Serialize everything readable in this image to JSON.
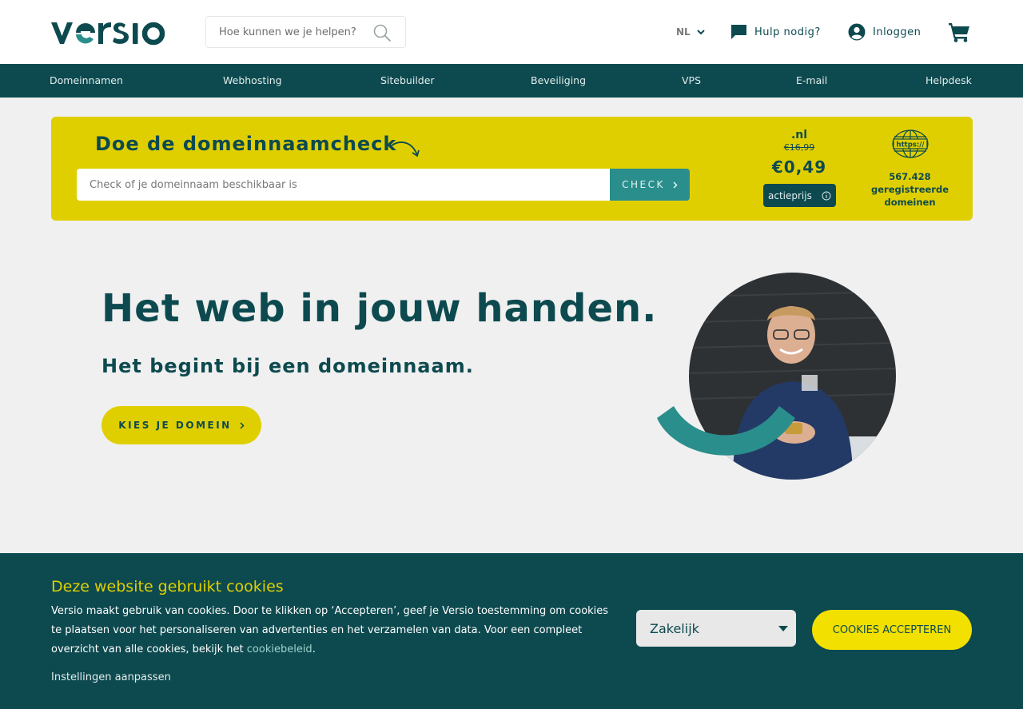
{
  "header": {
    "logo_text": "versio",
    "search_placeholder": "Hoe kunnen we je helpen?",
    "language": "NL",
    "help_label": "Hulp nodig?",
    "login_label": "Inloggen"
  },
  "nav": {
    "items": [
      "Domeinnamen",
      "Webhosting",
      "Sitebuilder",
      "Beveiliging",
      "VPS",
      "E-mail",
      "Helpdesk"
    ]
  },
  "domain_check": {
    "title": "Doe de domeinnaamcheck",
    "input_placeholder": "Check of je domeinnaam beschikbaar is",
    "button_label": "CHECK",
    "tld": ".nl",
    "old_price": "€16,99",
    "new_price": "€0,49",
    "promo_label": "actieprijs",
    "registered_count": "567.428",
    "registered_label": "geregistreerde domeinen",
    "https_text": "https://"
  },
  "hero": {
    "title": "Het web in jouw handen.",
    "subtitle": "Het begint bij een domeinnaam.",
    "cta_label": "KIES JE DOMEIN"
  },
  "cookie_banner": {
    "title": "Deze website gebruikt cookies",
    "text": "Versio maakt gebruik van cookies. Door te klikken op ‘Accepteren’, geef je Versio toestemming om cookies te plaatsen voor het personaliseren van advertenties en het verzamelen van data. Voor een compleet overzicht van alle cookies, bekijk het ",
    "policy_link": "cookiebeleid",
    "text_end": ".",
    "settings_label": "Instellingen aanpassen",
    "select_value": "Zakelijk",
    "accept_label": "COOKIES ACCEPTEREN"
  },
  "colors": {
    "brand_dark": "#0d4a4f",
    "brand_teal": "#2a8e8c",
    "brand_yellow": "#e0cf00"
  }
}
